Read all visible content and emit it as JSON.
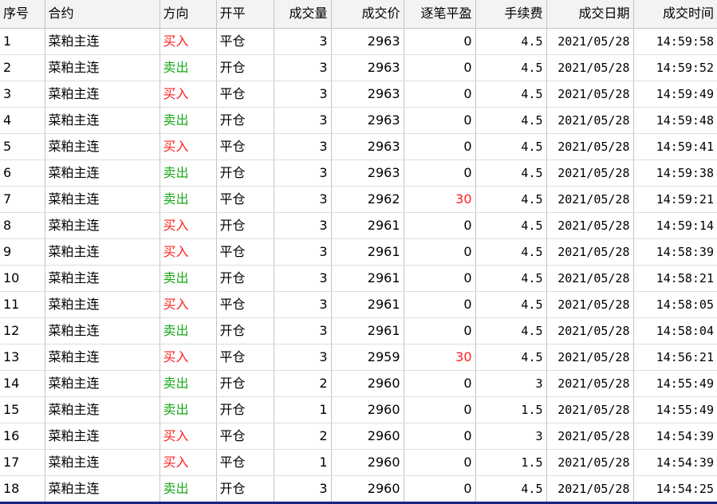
{
  "headers": [
    "序号",
    "合约",
    "方向",
    "开平",
    "成交量",
    "成交价",
    "逐笔平盈",
    "手续费",
    "成交日期",
    "成交时间"
  ],
  "colors": {
    "buy": "#ff2020",
    "sell": "#1aa81a",
    "profit": "#ff2020"
  },
  "rows": [
    {
      "seq": "1",
      "contract": "菜粕主连",
      "dir": "买入",
      "oc": "平仓",
      "qty": "3",
      "price": "2963",
      "pnl": "0",
      "fee": "4.5",
      "date": "2021/05/28",
      "time": "14:59:58"
    },
    {
      "seq": "2",
      "contract": "菜粕主连",
      "dir": "卖出",
      "oc": "开仓",
      "qty": "3",
      "price": "2963",
      "pnl": "0",
      "fee": "4.5",
      "date": "2021/05/28",
      "time": "14:59:52"
    },
    {
      "seq": "3",
      "contract": "菜粕主连",
      "dir": "买入",
      "oc": "平仓",
      "qty": "3",
      "price": "2963",
      "pnl": "0",
      "fee": "4.5",
      "date": "2021/05/28",
      "time": "14:59:49"
    },
    {
      "seq": "4",
      "contract": "菜粕主连",
      "dir": "卖出",
      "oc": "开仓",
      "qty": "3",
      "price": "2963",
      "pnl": "0",
      "fee": "4.5",
      "date": "2021/05/28",
      "time": "14:59:48"
    },
    {
      "seq": "5",
      "contract": "菜粕主连",
      "dir": "买入",
      "oc": "平仓",
      "qty": "3",
      "price": "2963",
      "pnl": "0",
      "fee": "4.5",
      "date": "2021/05/28",
      "time": "14:59:41"
    },
    {
      "seq": "6",
      "contract": "菜粕主连",
      "dir": "卖出",
      "oc": "开仓",
      "qty": "3",
      "price": "2963",
      "pnl": "0",
      "fee": "4.5",
      "date": "2021/05/28",
      "time": "14:59:38"
    },
    {
      "seq": "7",
      "contract": "菜粕主连",
      "dir": "卖出",
      "oc": "平仓",
      "qty": "3",
      "price": "2962",
      "pnl": "30",
      "fee": "4.5",
      "date": "2021/05/28",
      "time": "14:59:21"
    },
    {
      "seq": "8",
      "contract": "菜粕主连",
      "dir": "买入",
      "oc": "开仓",
      "qty": "3",
      "price": "2961",
      "pnl": "0",
      "fee": "4.5",
      "date": "2021/05/28",
      "time": "14:59:14"
    },
    {
      "seq": "9",
      "contract": "菜粕主连",
      "dir": "买入",
      "oc": "平仓",
      "qty": "3",
      "price": "2961",
      "pnl": "0",
      "fee": "4.5",
      "date": "2021/05/28",
      "time": "14:58:39"
    },
    {
      "seq": "10",
      "contract": "菜粕主连",
      "dir": "卖出",
      "oc": "开仓",
      "qty": "3",
      "price": "2961",
      "pnl": "0",
      "fee": "4.5",
      "date": "2021/05/28",
      "time": "14:58:21"
    },
    {
      "seq": "11",
      "contract": "菜粕主连",
      "dir": "买入",
      "oc": "平仓",
      "qty": "3",
      "price": "2961",
      "pnl": "0",
      "fee": "4.5",
      "date": "2021/05/28",
      "time": "14:58:05"
    },
    {
      "seq": "12",
      "contract": "菜粕主连",
      "dir": "卖出",
      "oc": "开仓",
      "qty": "3",
      "price": "2961",
      "pnl": "0",
      "fee": "4.5",
      "date": "2021/05/28",
      "time": "14:58:04"
    },
    {
      "seq": "13",
      "contract": "菜粕主连",
      "dir": "买入",
      "oc": "平仓",
      "qty": "3",
      "price": "2959",
      "pnl": "30",
      "fee": "4.5",
      "date": "2021/05/28",
      "time": "14:56:21"
    },
    {
      "seq": "14",
      "contract": "菜粕主连",
      "dir": "卖出",
      "oc": "开仓",
      "qty": "2",
      "price": "2960",
      "pnl": "0",
      "fee": "3",
      "date": "2021/05/28",
      "time": "14:55:49"
    },
    {
      "seq": "15",
      "contract": "菜粕主连",
      "dir": "卖出",
      "oc": "开仓",
      "qty": "1",
      "price": "2960",
      "pnl": "0",
      "fee": "1.5",
      "date": "2021/05/28",
      "time": "14:55:49"
    },
    {
      "seq": "16",
      "contract": "菜粕主连",
      "dir": "买入",
      "oc": "平仓",
      "qty": "2",
      "price": "2960",
      "pnl": "0",
      "fee": "3",
      "date": "2021/05/28",
      "time": "14:54:39"
    },
    {
      "seq": "17",
      "contract": "菜粕主连",
      "dir": "买入",
      "oc": "平仓",
      "qty": "1",
      "price": "2960",
      "pnl": "0",
      "fee": "1.5",
      "date": "2021/05/28",
      "time": "14:54:39"
    },
    {
      "seq": "18",
      "contract": "菜粕主连",
      "dir": "卖出",
      "oc": "开仓",
      "qty": "3",
      "price": "2960",
      "pnl": "0",
      "fee": "4.5",
      "date": "2021/05/28",
      "time": "14:54:25"
    }
  ]
}
